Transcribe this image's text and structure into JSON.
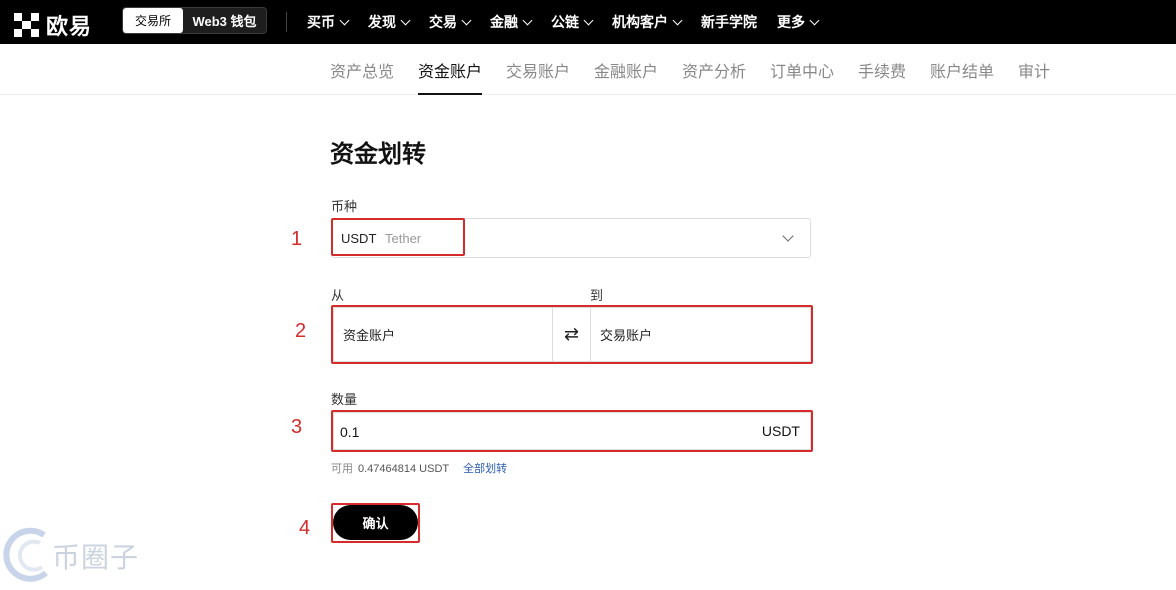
{
  "header": {
    "logo_text": "欧易",
    "segment": {
      "exchange": "交易所",
      "wallet": "Web3 钱包"
    },
    "menu": [
      {
        "label": "买币",
        "has_dropdown": true
      },
      {
        "label": "发现",
        "has_dropdown": true
      },
      {
        "label": "交易",
        "has_dropdown": true
      },
      {
        "label": "金融",
        "has_dropdown": true
      },
      {
        "label": "公链",
        "has_dropdown": true
      },
      {
        "label": "机构客户",
        "has_dropdown": true
      },
      {
        "label": "新手学院",
        "has_dropdown": false
      },
      {
        "label": "更多",
        "has_dropdown": true
      }
    ]
  },
  "subnav": {
    "tabs": [
      "资产总览",
      "资金账户",
      "交易账户",
      "金融账户",
      "资产分析",
      "订单中心",
      "手续费",
      "账户结单",
      "审计"
    ],
    "active": "资金账户"
  },
  "form": {
    "title": "资金划转",
    "coin_label": "币种",
    "coin_symbol": "USDT",
    "coin_name": "Tether",
    "from_label": "从",
    "to_label": "到",
    "from_account": "资金账户",
    "to_account": "交易账户",
    "swap_glyph": "⇄",
    "amount_label": "数量",
    "amount_value": "0.1",
    "amount_unit": "USDT",
    "available_label": "可用",
    "available_value": "0.47464814 USDT",
    "transfer_all": "全部划转",
    "confirm_label": "确认"
  },
  "annotations": [
    "1",
    "2",
    "3",
    "4"
  ],
  "watermark": "币圈子",
  "colors": {
    "annotation_red": "#d42b2b",
    "link_blue": "#2a5db0",
    "topbar": "#000000"
  }
}
